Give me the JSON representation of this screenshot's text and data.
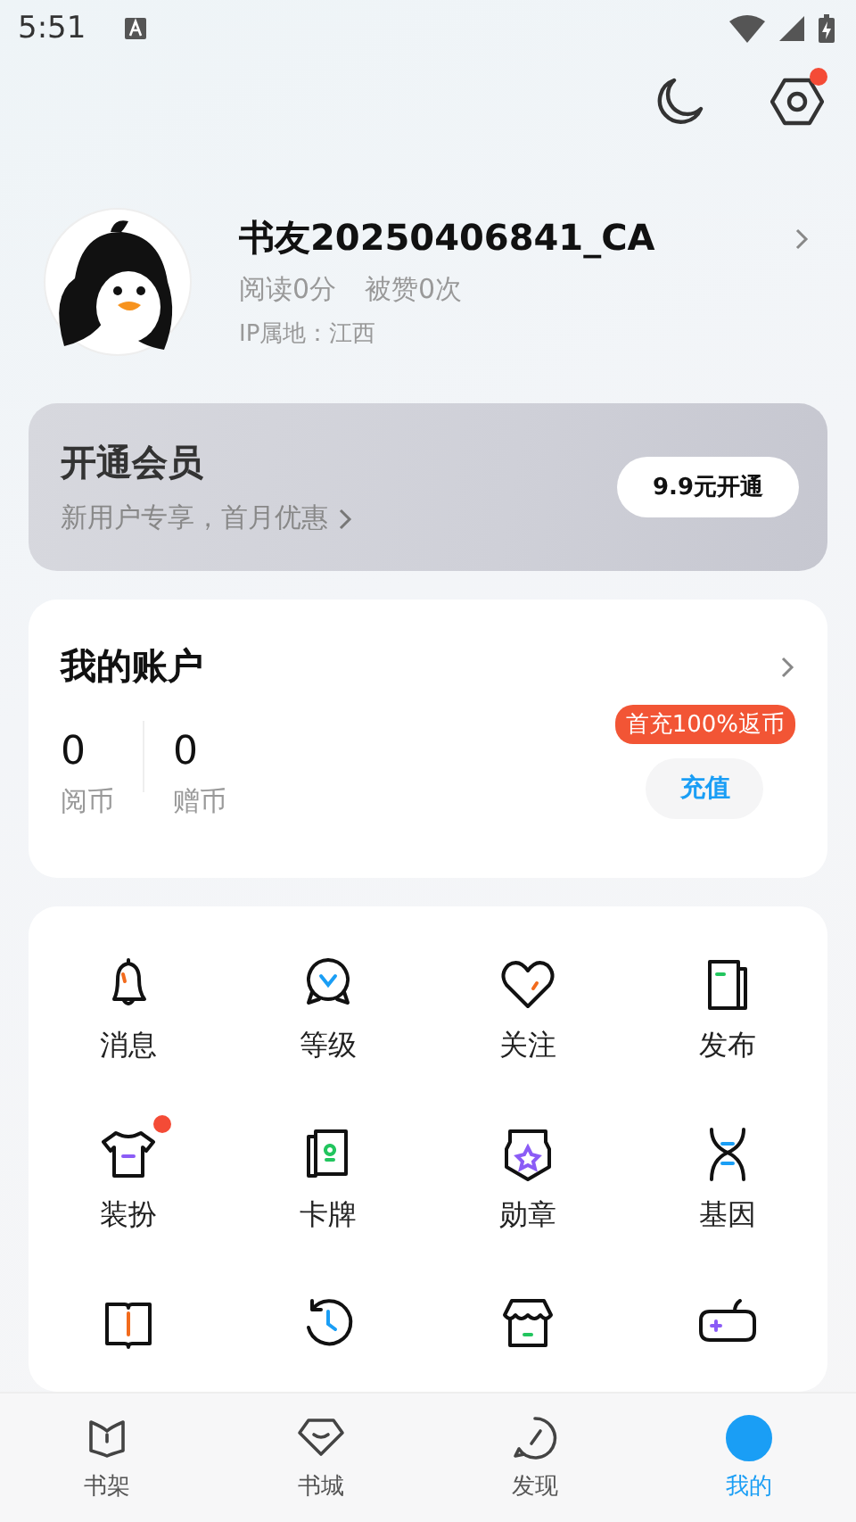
{
  "status_bar": {
    "time": "5:51"
  },
  "header": {
    "settings_badge": true
  },
  "profile": {
    "name": "书友20250406841_CA",
    "reads": "阅读0分",
    "likes": "被赞0次",
    "ip": "IP属地：江西"
  },
  "vip": {
    "title": "开通会员",
    "subtitle": "新用户专享，首月优惠",
    "button": "9.9元开通"
  },
  "account": {
    "title": "我的账户",
    "balances": [
      {
        "value": "0",
        "label": "阅币"
      },
      {
        "value": "0",
        "label": "赠币"
      }
    ],
    "promo": "首充100%返币",
    "button": "充值"
  },
  "grid": [
    {
      "label": "消息",
      "badge": false
    },
    {
      "label": "等级",
      "badge": false
    },
    {
      "label": "关注",
      "badge": false
    },
    {
      "label": "发布",
      "badge": false
    },
    {
      "label": "装扮",
      "badge": true
    },
    {
      "label": "卡牌",
      "badge": false
    },
    {
      "label": "勋章",
      "badge": false
    },
    {
      "label": "基因",
      "badge": false
    },
    {
      "badge": false
    },
    {
      "badge": false
    },
    {
      "badge": false
    },
    {
      "badge": false
    }
  ],
  "tabs": [
    {
      "label": "书架",
      "selected": false
    },
    {
      "label": "书城",
      "selected": false
    },
    {
      "label": "发现",
      "selected": false
    },
    {
      "label": "我的",
      "selected": true
    }
  ]
}
